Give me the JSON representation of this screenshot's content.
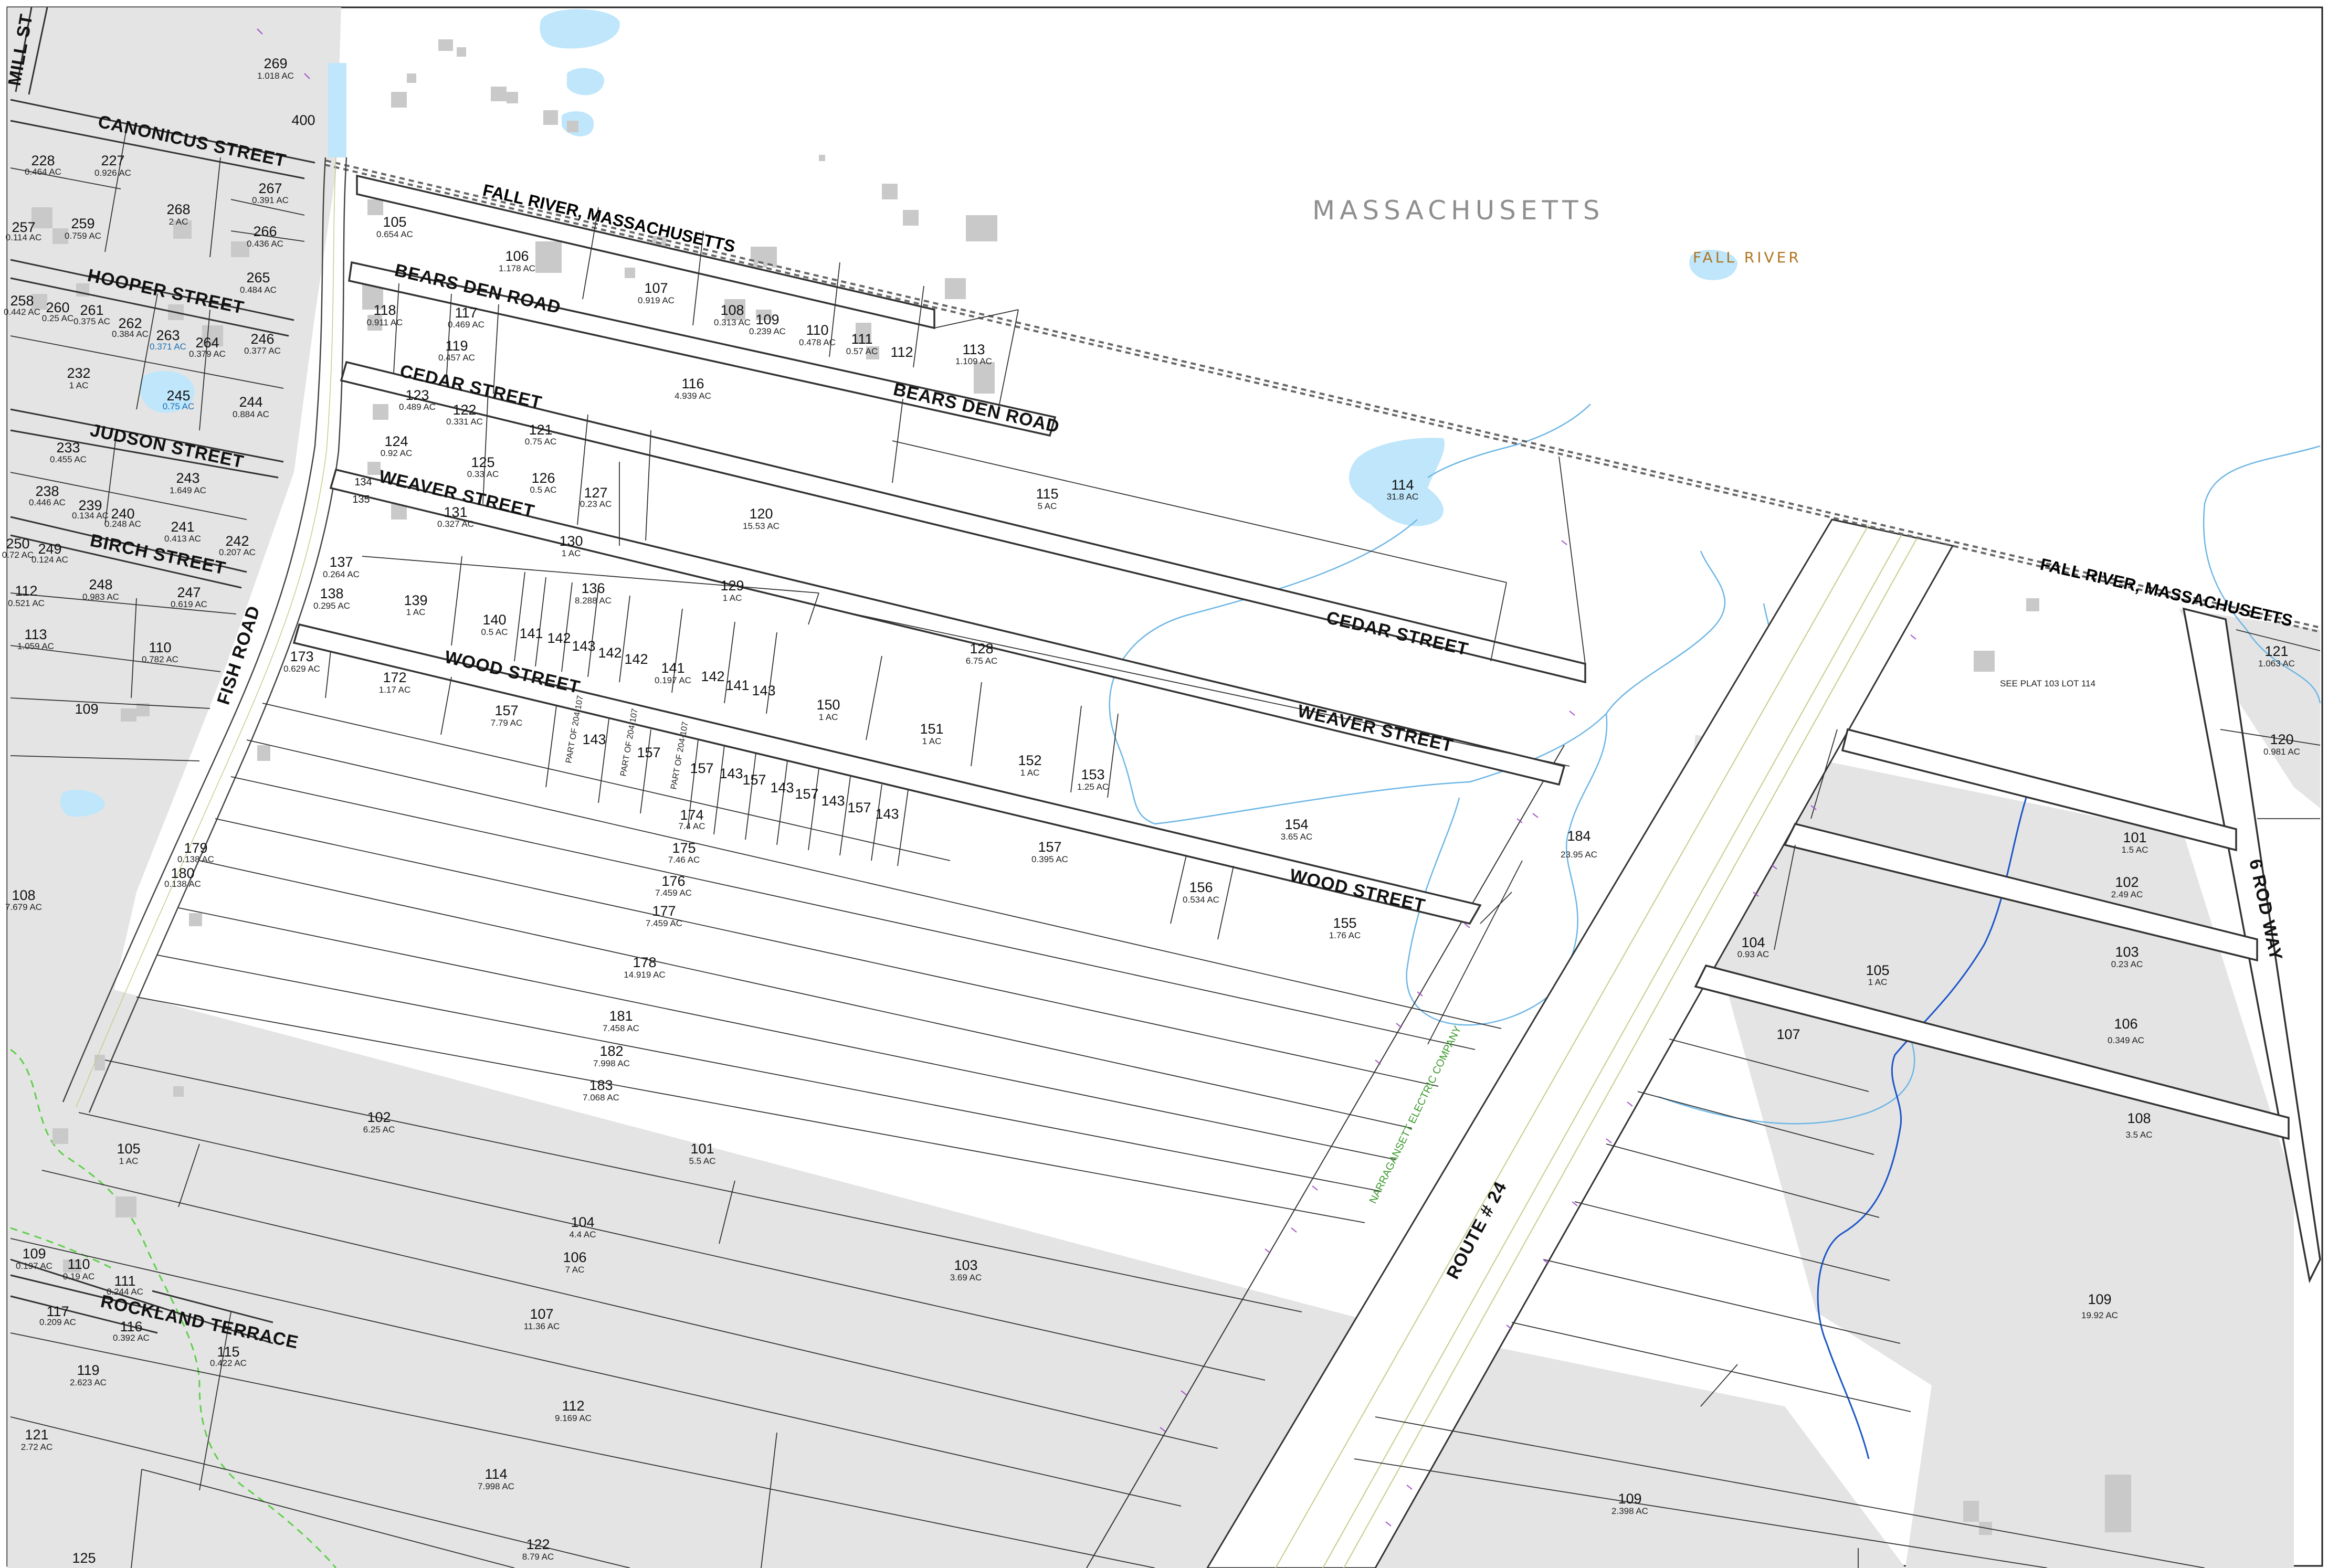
{
  "regions": {
    "state": "MASSACHUSETTS",
    "town": "FALL RIVER",
    "border_label_1": "FALL RIVER, MASSACHUSETTS",
    "border_label_2": "FALL RIVER, MASSACHUSETTS"
  },
  "streets": {
    "mill": "MILL ST",
    "canonicus": "CANONICUS STREET",
    "hooper": "HOOPER STREET",
    "judson": "JUDSON STREET",
    "birch": "BIRCH STREET",
    "fish_road": "FISH ROAD",
    "bears_den_1": "BEARS DEN ROAD",
    "bears_den_2": "BEARS DEN ROAD",
    "cedar_1": "CEDAR STREET",
    "cedar_2": "CEDAR STREET",
    "weaver_1": "WEAVER STREET",
    "weaver_2": "WEAVER STREET",
    "wood_1": "WOOD STREET",
    "wood_2": "WOOD STREET",
    "rockland": "ROCKLAND TERRACE",
    "route24": "ROUTE # 24",
    "six_rod": "6 ROD WAY",
    "narragansett": "NARRAGANSETT ELECTRIC COMPANY"
  },
  "notes": {
    "see_plat": "SEE PLAT 103 LOT 114",
    "part_of_1": "PART OF 204-107",
    "part_of_2": "PART OF 204-107",
    "part_of_3": "PART OF 204-107"
  },
  "lots": [
    {
      "num": "269",
      "area": "1.018 AC"
    },
    {
      "num": "400",
      "area": ""
    },
    {
      "num": "228",
      "area": "0.464 AC"
    },
    {
      "num": "227",
      "area": "0.926 AC"
    },
    {
      "num": "268",
      "area": "2 AC"
    },
    {
      "num": "267",
      "area": "0.391 AC"
    },
    {
      "num": "257",
      "area": "0.114 AC"
    },
    {
      "num": "259",
      "area": "0.759 AC"
    },
    {
      "num": "266",
      "area": "0.436 AC"
    },
    {
      "num": "265",
      "area": "0.484 AC"
    },
    {
      "num": "258",
      "area": "0.442 AC"
    },
    {
      "num": "260",
      "area": "0.25 AC"
    },
    {
      "num": "261",
      "area": "0.375 AC"
    },
    {
      "num": "262",
      "area": "0.384 AC"
    },
    {
      "num": "263",
      "area": "0.371 AC"
    },
    {
      "num": "264",
      "area": "0.379 AC"
    },
    {
      "num": "246",
      "area": "0.377 AC"
    },
    {
      "num": "232",
      "area": "1 AC"
    },
    {
      "num": "245",
      "area": "0.75 AC"
    },
    {
      "num": "244",
      "area": "0.884 AC"
    },
    {
      "num": "233",
      "area": "0.455 AC"
    },
    {
      "num": "243",
      "area": "1.649 AC"
    },
    {
      "num": "238",
      "area": "0.446 AC"
    },
    {
      "num": "239",
      "area": "0.134 AC"
    },
    {
      "num": "240",
      "area": "0.248 AC"
    },
    {
      "num": "241",
      "area": "0.413 AC"
    },
    {
      "num": "242",
      "area": "0.207 AC"
    },
    {
      "num": "250",
      "area": "0.72 AC"
    },
    {
      "num": "249",
      "area": "0.124 AC"
    },
    {
      "num": "112",
      "area": "0.521 AC"
    },
    {
      "num": "248",
      "area": "0.983 AC"
    },
    {
      "num": "247",
      "area": "0.619 AC"
    },
    {
      "num": "113",
      "area": "1.059 AC"
    },
    {
      "num": "110",
      "area": "0.782 AC"
    },
    {
      "num": "109",
      "area": ""
    },
    {
      "num": "108",
      "area": "7.679 AC"
    },
    {
      "num": "105",
      "area": "0.654 AC"
    },
    {
      "num": "106",
      "area": "1.178 AC"
    },
    {
      "num": "107",
      "area": "0.919 AC"
    },
    {
      "num": "108",
      "area": "0.313 AC"
    },
    {
      "num": "109",
      "area": "0.239 AC"
    },
    {
      "num": "110",
      "area": "0.478 AC"
    },
    {
      "num": "111",
      "area": "0.57 AC"
    },
    {
      "num": "112",
      "area": ""
    },
    {
      "num": "113",
      "area": "1.109 AC"
    },
    {
      "num": "118",
      "area": "0.911 AC"
    },
    {
      "num": "117",
      "area": "0.469 AC"
    },
    {
      "num": "119",
      "area": "0.457 AC"
    },
    {
      "num": "116",
      "area": "4.939 AC"
    },
    {
      "num": "123",
      "area": "0.489 AC"
    },
    {
      "num": "122",
      "area": "0.331 AC"
    },
    {
      "num": "121",
      "area": "0.75 AC"
    },
    {
      "num": "124",
      "area": "0.92 AC"
    },
    {
      "num": "125",
      "area": "0.33 AC"
    },
    {
      "num": "126",
      "area": "0.5 AC"
    },
    {
      "num": "127",
      "area": "0.23 AC"
    },
    {
      "num": "120",
      "area": "15.53 AC"
    },
    {
      "num": "115",
      "area": "5 AC"
    },
    {
      "num": "114",
      "area": "31.8 AC"
    },
    {
      "num": "134",
      "area": ""
    },
    {
      "num": "135",
      "area": ""
    },
    {
      "num": "131",
      "area": "0.327 AC"
    },
    {
      "num": "130",
      "area": "1 AC"
    },
    {
      "num": "137",
      "area": "0.264 AC"
    },
    {
      "num": "138",
      "area": "0.295 AC"
    },
    {
      "num": "139",
      "area": "1 AC"
    },
    {
      "num": "136",
      "area": "8.288 AC"
    },
    {
      "num": "129",
      "area": "1 AC"
    },
    {
      "num": "128",
      "area": "6.75 AC"
    },
    {
      "num": "140",
      "area": "0.5 AC"
    },
    {
      "num": "141",
      "area": ""
    },
    {
      "num": "142",
      "area": ""
    },
    {
      "num": "143",
      "area": ""
    },
    {
      "num": "142",
      "area": ""
    },
    {
      "num": "142",
      "area": ""
    },
    {
      "num": "141",
      "area": "0.197 AC"
    },
    {
      "num": "142",
      "area": ""
    },
    {
      "num": "141",
      "area": ""
    },
    {
      "num": "143",
      "area": ""
    },
    {
      "num": "150",
      "area": "1 AC"
    },
    {
      "num": "151",
      "area": "1 AC"
    },
    {
      "num": "152",
      "area": "1 AC"
    },
    {
      "num": "153",
      "area": "1.25 AC"
    },
    {
      "num": "173",
      "area": "0.629 AC"
    },
    {
      "num": "172",
      "area": "1.17 AC"
    },
    {
      "num": "157",
      "area": "7.79 AC"
    },
    {
      "num": "143",
      "area": ""
    },
    {
      "num": "157",
      "area": ""
    },
    {
      "num": "157",
      "area": ""
    },
    {
      "num": "143",
      "area": ""
    },
    {
      "num": "157",
      "area": ""
    },
    {
      "num": "143",
      "area": ""
    },
    {
      "num": "157",
      "area": ""
    },
    {
      "num": "143",
      "area": ""
    },
    {
      "num": "157",
      "area": ""
    },
    {
      "num": "143",
      "area": ""
    },
    {
      "num": "157",
      "area": "0.395 AC"
    },
    {
      "num": "154",
      "area": "3.65 AC"
    },
    {
      "num": "184",
      "area": "23.95 AC"
    },
    {
      "num": "174",
      "area": "7.4 AC"
    },
    {
      "num": "175",
      "area": "7.46 AC"
    },
    {
      "num": "176",
      "area": "7.459 AC"
    },
    {
      "num": "177",
      "area": "7.459 AC"
    },
    {
      "num": "179",
      "area": "0.138 AC"
    },
    {
      "num": "180",
      "area": "0.138 AC"
    },
    {
      "num": "156",
      "area": "0.534 AC"
    },
    {
      "num": "155",
      "area": "1.76 AC"
    },
    {
      "num": "178",
      "area": "14.919 AC"
    },
    {
      "num": "181",
      "area": "7.458 AC"
    },
    {
      "num": "182",
      "area": "7.998 AC"
    },
    {
      "num": "183",
      "area": "7.068 AC"
    },
    {
      "num": "102",
      "area": "6.25 AC"
    },
    {
      "num": "105",
      "area": "1 AC"
    },
    {
      "num": "101",
      "area": "5.5 AC"
    },
    {
      "num": "104",
      "area": "4.4 AC"
    },
    {
      "num": "106",
      "area": "7 AC"
    },
    {
      "num": "103",
      "area": "3.69 AC"
    },
    {
      "num": "109",
      "area": "0.197 AC"
    },
    {
      "num": "110",
      "area": "0.19 AC"
    },
    {
      "num": "111",
      "area": "0.244 AC"
    },
    {
      "num": "117",
      "area": "0.209 AC"
    },
    {
      "num": "116",
      "area": "0.392 AC"
    },
    {
      "num": "115",
      "area": "0.422 AC"
    },
    {
      "num": "107",
      "area": "11.36 AC"
    },
    {
      "num": "119",
      "area": "2.623 AC"
    },
    {
      "num": "112",
      "area": "9.169 AC"
    },
    {
      "num": "121",
      "area": "2.72 AC"
    },
    {
      "num": "114",
      "area": "7.998 AC"
    },
    {
      "num": "125",
      "area": ""
    },
    {
      "num": "122",
      "area": "8.79 AC"
    },
    {
      "num": "121",
      "area": "1.063 AC"
    },
    {
      "num": "120",
      "area": "0.981 AC"
    },
    {
      "num": "101",
      "area": "1.5 AC"
    },
    {
      "num": "102",
      "area": "2.49 AC"
    },
    {
      "num": "103",
      "area": "0.23 AC"
    },
    {
      "num": "104",
      "area": "0.93 AC"
    },
    {
      "num": "105",
      "area": "1 AC"
    },
    {
      "num": "106",
      "area": "0.349 AC"
    },
    {
      "num": "107",
      "area": ""
    },
    {
      "num": "108",
      "area": "3.5 AC"
    },
    {
      "num": "109",
      "area": "19.92 AC"
    },
    {
      "num": "109",
      "area": "2.398 AC"
    }
  ],
  "colors": {
    "water": "#bfe6fb",
    "stream": "#6cb6e6",
    "stream_dark": "#1b55c8",
    "boundary_dash": "#555555",
    "trail": "#5fd04a",
    "shaded_lot": "#e4e4e4",
    "building": "#c9c9c9",
    "route_line": "#c9c98a"
  }
}
